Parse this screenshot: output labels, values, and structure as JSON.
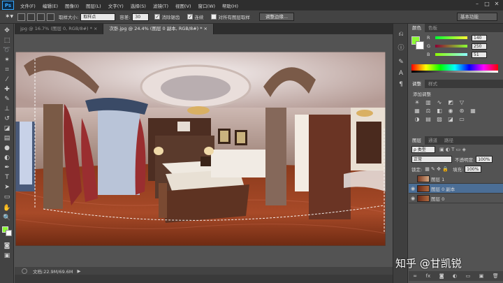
{
  "menubar": {
    "logo": "Ps",
    "items": [
      "文件(F)",
      "编辑(E)",
      "图像(I)",
      "图层(L)",
      "文字(Y)",
      "选择(S)",
      "滤镜(T)",
      "视图(V)",
      "窗口(W)",
      "帮助(H)"
    ]
  },
  "options": {
    "size_label": "取样大小:",
    "size_value": "取样点",
    "tolerance_label": "容差:",
    "tolerance_value": "30",
    "antialias_label": "消除锯齿",
    "contiguous_label": "连续",
    "sample_all_label": "对所有图层取样",
    "refine_button": "调整边缘...",
    "workspace": "基本功能"
  },
  "tabs": [
    {
      "label": "jpg @ 16.7% (图层 0, RGB/8#) * ×",
      "active": false
    },
    {
      "label": "次卧.jpg @ 24.4% (图层 0 副本, RGB/8#) * ×",
      "active": true
    }
  ],
  "status": {
    "zoom": "",
    "doc_info": "文档:22.9M/69.6M"
  },
  "color_panel": {
    "tabs": [
      "颜色",
      "色板"
    ],
    "r_label": "R",
    "r_value": "140",
    "g_label": "G",
    "g_value": "250",
    "b_label": "B",
    "b_value": "51",
    "foreground": "#8cfa33"
  },
  "adjust_panel": {
    "tabs": [
      "调整",
      "样式"
    ],
    "title": "添加调整"
  },
  "layers_panel": {
    "tabs": [
      "图层",
      "通道",
      "路径"
    ],
    "filter_label": "ρ 类型",
    "blend_mode": "正常",
    "opacity_label": "不透明度:",
    "opacity_value": "100%",
    "lock_label": "锁定:",
    "fill_label": "填充:",
    "fill_value": "100%",
    "layers": [
      {
        "name": "图层 1",
        "selected": false
      },
      {
        "name": "图层 0 副本",
        "selected": true
      },
      {
        "name": "图层 0",
        "selected": false
      }
    ]
  },
  "watermark": "知乎 @甘凯锐"
}
